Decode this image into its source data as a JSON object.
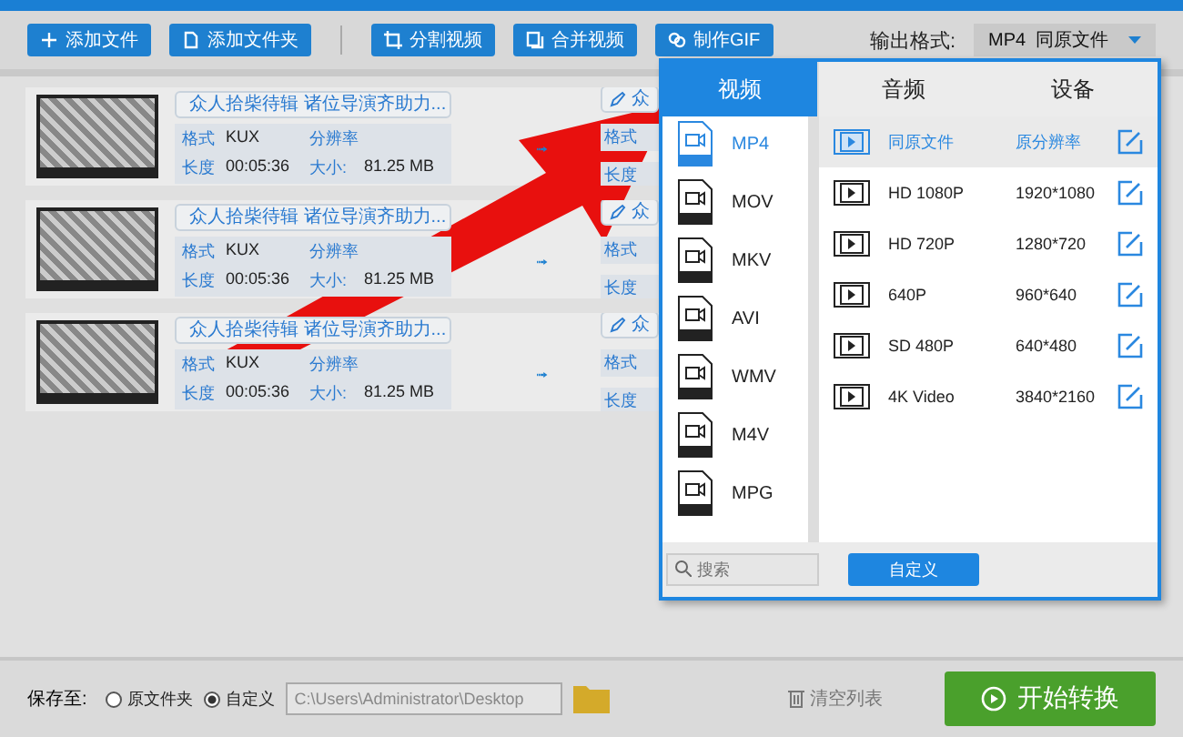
{
  "toolbar": {
    "buttons": [
      {
        "label": "添加文件",
        "kind": "plus"
      },
      {
        "label": "添加文件夹",
        "kind": "file"
      },
      {
        "label": "分割视频",
        "kind": "crop"
      },
      {
        "label": "合并视频",
        "kind": "merge"
      },
      {
        "label": "制作GIF",
        "kind": "link"
      }
    ],
    "output_format": {
      "label": "输出格式:",
      "value": "MP4  同原文件"
    }
  },
  "files": [
    {
      "name": "众人拾柴待辑 诸位导演齐助力...",
      "format_label": "格式",
      "format": "KUX",
      "resolution_label": "分辨率",
      "duration_label": "长度",
      "duration": "00:05:36",
      "size_label": "大小:",
      "size": "81.25 MB",
      "output": {
        "name": "众",
        "format_label": "格式",
        "duration_label": "长度"
      }
    },
    {
      "name": "众人拾柴待辑 诸位导演齐助力...",
      "format_label": "格式",
      "format": "KUX",
      "resolution_label": "分辨率",
      "duration_label": "长度",
      "duration": "00:05:36",
      "size_label": "大小:",
      "size": "81.25 MB",
      "output": {
        "name": "众",
        "format_label": "格式",
        "duration_label": "长度"
      }
    },
    {
      "name": "众人拾柴待辑 诸位导演齐助力...",
      "format_label": "格式",
      "format": "KUX",
      "resolution_label": "分辨率",
      "duration_label": "长度",
      "duration": "00:05:36",
      "size_label": "大小:",
      "size": "81.25 MB",
      "output": {
        "name": "众",
        "format_label": "格式",
        "duration_label": "长度"
      }
    }
  ],
  "popup": {
    "categories": [
      {
        "label": "视频",
        "selected": true
      },
      {
        "label": "音频",
        "selected": false
      },
      {
        "label": "设备",
        "selected": false
      }
    ],
    "formats": [
      {
        "label": "MP4",
        "selected": true
      },
      {
        "label": "MOV",
        "selected": false
      },
      {
        "label": "MKV",
        "selected": false
      },
      {
        "label": "AVI",
        "selected": false
      },
      {
        "label": "WMV",
        "selected": false
      },
      {
        "label": "M4V",
        "selected": false
      },
      {
        "label": "MPG",
        "selected": false
      }
    ],
    "presets": [
      {
        "name": "同原文件",
        "resolution": "原分辨率",
        "selected": true
      },
      {
        "name": "HD 1080P",
        "resolution": "1920*1080",
        "selected": false
      },
      {
        "name": "HD 720P",
        "resolution": "1280*720",
        "selected": false
      },
      {
        "name": "640P",
        "resolution": "960*640",
        "selected": false
      },
      {
        "name": "SD 480P",
        "resolution": "640*480",
        "selected": false
      },
      {
        "name": "4K Video",
        "resolution": "3840*2160",
        "selected": false
      }
    ],
    "search": {
      "placeholder": "搜索"
    },
    "custom_button": "自定义"
  },
  "bottom": {
    "save_label": "保存至:",
    "options": [
      {
        "label": "原文件夹",
        "selected": false
      },
      {
        "label": "自定义",
        "selected": true
      }
    ],
    "path": "C:\\Users\\Administrator\\Desktop",
    "clear_label": "清空列表",
    "start_label": "开始转换"
  }
}
